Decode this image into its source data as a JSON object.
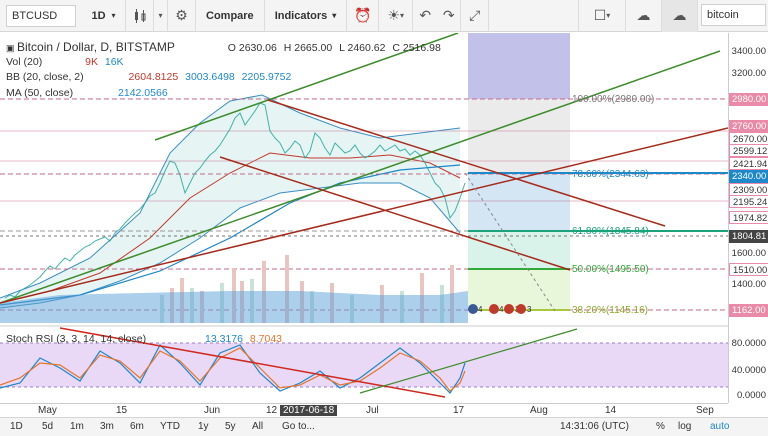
{
  "toolbar": {
    "symbol": "BTCUSD",
    "interval": "1D",
    "compare": "Compare",
    "indicators": "Indicators",
    "search": "bitcoin"
  },
  "legend": {
    "title": "Bitcoin / Dollar, D, BITSTAMP",
    "o": "O 2630.06",
    "h": "H 2665.00",
    "l": "L 2460.62",
    "c": "C 2516.98",
    "vol_label": "Vol (20)",
    "vol_v1": "9K",
    "vol_v2": "16K",
    "bb_label": "BB (20, close, 2)",
    "bb_v1": "2604.8125",
    "bb_v2": "3003.6498",
    "bb_v3": "2205.9752",
    "ma_label": "MA (50, close)",
    "ma_v": "2142.0566",
    "rsi_label": "Stoch RSI (3, 3, 14, 14, close)",
    "rsi_v1": "13.3176",
    "rsi_v2": "8.7043"
  },
  "price_ticks": [
    "3400.00",
    "3200.00",
    "2980.00",
    "2760.00",
    "2670.00",
    "2599.12",
    "2421.94",
    "2340.00",
    "2309.00",
    "2195.24",
    "1974.82",
    "1804.81",
    "1600.00",
    "1510.00",
    "1400.00",
    "1162.00"
  ],
  "fib": {
    "f100": "100.00%(2980.00)",
    "f786": "78.60%(2344.63)",
    "f618": "61.80%(1845.84)",
    "f50": "50.00%(1495.50)",
    "f382": "38.20%(1145.16)"
  },
  "rsi_ticks": [
    "80.0000",
    "40.0000",
    "0.0000"
  ],
  "time_labels": [
    "May",
    "15",
    "Jun",
    "12",
    "2017-06-18",
    "Jul",
    "17",
    "Aug",
    "14",
    "Sep"
  ],
  "markers": {
    "m1": "4",
    "m2": "4",
    "m3": "3",
    "m4": "3"
  },
  "bottom": {
    "ranges": [
      "1D",
      "5d",
      "1m",
      "3m",
      "6m",
      "YTD",
      "1y",
      "5y",
      "All",
      "Go to..."
    ],
    "time": "14:31:06 (UTC)",
    "pct": "%",
    "log": "log",
    "auto": "auto"
  }
}
